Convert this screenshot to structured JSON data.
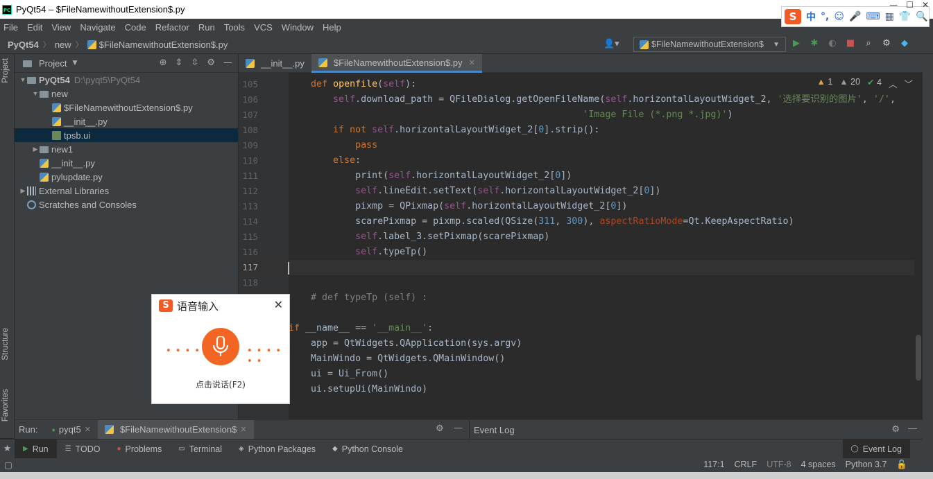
{
  "window": {
    "title": "PyQt54 – $FileNamewithoutExtension$.py",
    "app_icon_text": "PC"
  },
  "ime_toolbar": {
    "logo": "S",
    "items": [
      "中",
      "°,",
      "☺",
      "🎤",
      "⌨",
      "▦",
      "👕",
      "🔍"
    ]
  },
  "menu": [
    "File",
    "Edit",
    "View",
    "Navigate",
    "Code",
    "Refactor",
    "Run",
    "Tools",
    "VCS",
    "Window",
    "Help"
  ],
  "breadcrumb": {
    "project": "PyQt54",
    "folder": "new",
    "file": "$FileNamewithoutExtension$.py"
  },
  "run_config": {
    "label": "$FileNamewithoutExtension$"
  },
  "left_strip": {
    "project_tab": "Project",
    "structure_tab": "Structure",
    "favorites_tab": "Favorites"
  },
  "project_panel": {
    "title": "Project",
    "tree": [
      {
        "label": "PyQt54",
        "path": "D:\\pyqt5\\PyQt54",
        "indent": 0,
        "arrow": "open",
        "icon": "folder",
        "bold": true
      },
      {
        "label": "new",
        "indent": 1,
        "arrow": "open",
        "icon": "folder"
      },
      {
        "label": "$FileNamewithoutExtension$.py",
        "indent": 2,
        "icon": "pyfile"
      },
      {
        "label": "__init__.py",
        "indent": 2,
        "icon": "pyfile"
      },
      {
        "label": "tpsb.ui",
        "indent": 2,
        "icon": "uifile",
        "selected": true
      },
      {
        "label": "new1",
        "indent": 1,
        "arrow": "closed",
        "icon": "folder"
      },
      {
        "label": "__init__.py",
        "indent": 1,
        "icon": "pyfile"
      },
      {
        "label": "pylupdate.py",
        "indent": 1,
        "icon": "pyfile"
      },
      {
        "label": "External Libraries",
        "indent": 0,
        "arrow": "closed",
        "icon": "lib"
      },
      {
        "label": "Scratches and Consoles",
        "indent": 0,
        "icon": "scratch"
      }
    ]
  },
  "editor_tabs": [
    {
      "label": "__init__.py",
      "active": false
    },
    {
      "label": "$FileNamewithoutExtension$.py",
      "active": true
    }
  ],
  "inspections": {
    "warnings": "1",
    "weak_warnings": "20",
    "typos": "4"
  },
  "code_lines": [
    {
      "num": "105",
      "html": "    <span class=\"kw\">def</span> <span class=\"fn\">openfile</span>(<span class=\"self\">self</span>):"
    },
    {
      "num": "106",
      "html": "        <span class=\"self\">self</span>.download_path = QFileDialog.getOpenFileName(<span class=\"self\">self</span>.horizontalLayoutWidget_2, <span class=\"str\">'选择要识别的图片'</span>, <span class=\"str\">'/'</span>,"
    },
    {
      "num": "107",
      "html": "                                                     <span class=\"str\">'Image File (*.png *.jpg)'</span>)"
    },
    {
      "num": "108",
      "html": "        <span class=\"kw\">if not</span> <span class=\"self\">self</span>.horizontalLayoutWidget_2[<span class=\"num\">0</span>].strip():"
    },
    {
      "num": "109",
      "html": "            <span class=\"kw\">pass</span>"
    },
    {
      "num": "110",
      "html": "        <span class=\"kw\">else</span>:"
    },
    {
      "num": "111",
      "html": "            print(<span class=\"self\">self</span>.horizontalLayoutWidget_2[<span class=\"num\">0</span>])"
    },
    {
      "num": "112",
      "html": "            <span class=\"self\">self</span>.lineEdit.setText(<span class=\"self\">self</span>.horizontalLayoutWidget_2[<span class=\"num\">0</span>])"
    },
    {
      "num": "113",
      "html": "            pixmp = QPixmap(<span class=\"self\">self</span>.horizontalLayoutWidget_2[<span class=\"num\">0</span>])"
    },
    {
      "num": "114",
      "html": "            scarePixmap = pixmp.scaled(QSize(<span class=\"num\">311</span>, <span class=\"num\">300</span>), <span class=\"param\">aspectRatioMode</span>=Qt.KeepAspectRatio)"
    },
    {
      "num": "115",
      "html": "            <span class=\"self\">self</span>.label_3.setPixmap(scarePixmap)"
    },
    {
      "num": "116",
      "html": "            <span class=\"self\">self</span>.typeTp()"
    },
    {
      "num": "117",
      "html": "",
      "current": true
    },
    {
      "num": "118",
      "html": ""
    },
    {
      "num": "",
      "html": "    <span class=\"cmt\"># def typeTp (self) :</span>"
    },
    {
      "num": "",
      "html": ""
    },
    {
      "num": "",
      "html": "<span class=\"kw\">if</span> __name__ == <span class=\"str\">'__main__'</span>:"
    },
    {
      "num": "",
      "html": "    app = QtWidgets.QApplication(sys.argv)"
    },
    {
      "num": "",
      "html": "    MainWindo = QtWidgets.QMainWindow()"
    },
    {
      "num": "",
      "html": "    ui = Ui_From()"
    },
    {
      "num": "",
      "html": "    ui.setupUi(MainWindo)"
    }
  ],
  "run_bar": {
    "label": "Run:",
    "tabs": [
      {
        "label": "pyqt5",
        "active": false
      },
      {
        "label": "$FileNamewithoutExtension$",
        "active": true
      }
    ],
    "event_log_title": "Event Log"
  },
  "bottom_tools": [
    {
      "label": "Run",
      "icon": "▶",
      "active": true
    },
    {
      "label": "TODO",
      "icon": "☰"
    },
    {
      "label": "Problems",
      "icon": "●"
    },
    {
      "label": "Terminal",
      "icon": "▭"
    },
    {
      "label": "Python Packages",
      "icon": "◈"
    },
    {
      "label": "Python Console",
      "icon": "◆"
    }
  ],
  "event_log_button": "Event Log",
  "status": {
    "position": "117:1",
    "line_sep": "CRLF",
    "encoding": "UTF-8",
    "indent": "4 spaces",
    "interpreter": "Python 3.7"
  },
  "voice_popup": {
    "logo": "S",
    "title": "语音输入",
    "close": "✕",
    "hint": "点击说话(F2)",
    "dots": "• • • • • •"
  },
  "colors": {
    "accent": "#f26522",
    "selection": "#0d293e",
    "tab_underline": "#4a88c7"
  }
}
